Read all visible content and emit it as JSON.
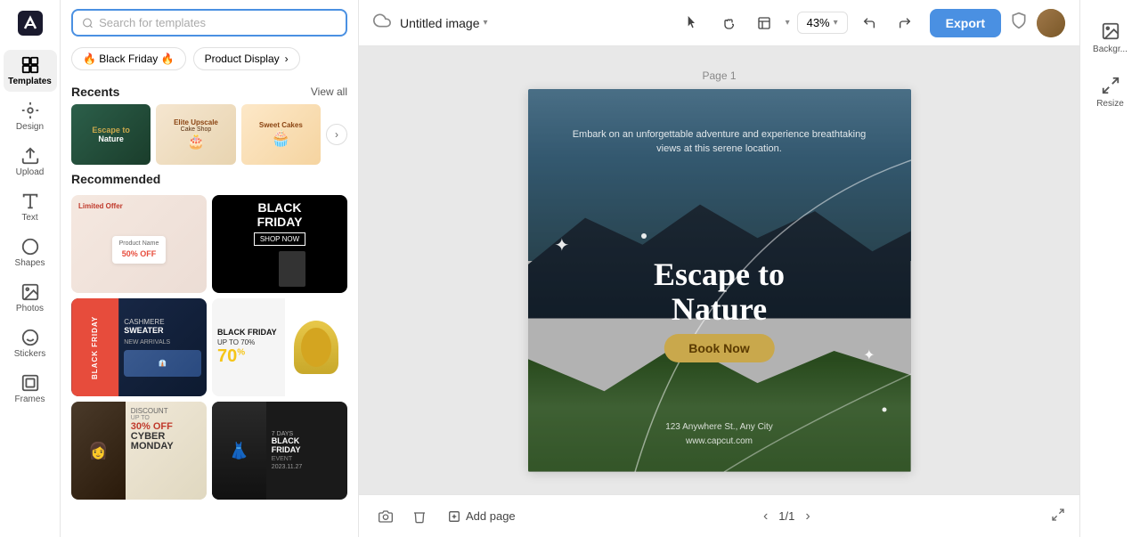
{
  "app": {
    "logo_label": "✂",
    "title": "Untitled image",
    "title_caret": "▾",
    "export_label": "Export"
  },
  "sidebar": {
    "items": [
      {
        "id": "templates",
        "label": "Templates",
        "active": true
      },
      {
        "id": "design",
        "label": "Design",
        "active": false
      },
      {
        "id": "upload",
        "label": "Upload",
        "active": false
      },
      {
        "id": "text",
        "label": "Text",
        "active": false
      },
      {
        "id": "shapes",
        "label": "Shapes",
        "active": false
      },
      {
        "id": "photos",
        "label": "Photos",
        "active": false
      },
      {
        "id": "stickers",
        "label": "Stickers",
        "active": false
      },
      {
        "id": "frames",
        "label": "Frames",
        "active": false
      }
    ]
  },
  "templates_panel": {
    "search_placeholder": "Search for templates",
    "filters": [
      {
        "label": "🔥 Black Friday 🔥",
        "active": false
      },
      {
        "label": "Product Display",
        "active": false,
        "has_arrow": true
      }
    ],
    "recents": {
      "title": "Recents",
      "view_all": "View all"
    },
    "recommended": {
      "title": "Recommended"
    }
  },
  "canvas": {
    "page_label": "Page 1",
    "subtitle": "Embark on an unforgettable adventure and experience breathtaking views\nat this serene location.",
    "main_title_line1": "Escape to",
    "main_title_line2": "Nature",
    "book_now": "Book Now",
    "address_line1": "123 Anywhere St., Any City",
    "address_line2": "www.capcut.com"
  },
  "toolbar": {
    "zoom": "43%"
  },
  "bottom_bar": {
    "add_page": "Add page",
    "page_current": "1",
    "page_total": "1",
    "page_separator": "/"
  },
  "right_panel": {
    "items": [
      {
        "id": "background",
        "label": "Backgr..."
      },
      {
        "id": "resize",
        "label": "Resize"
      }
    ]
  }
}
